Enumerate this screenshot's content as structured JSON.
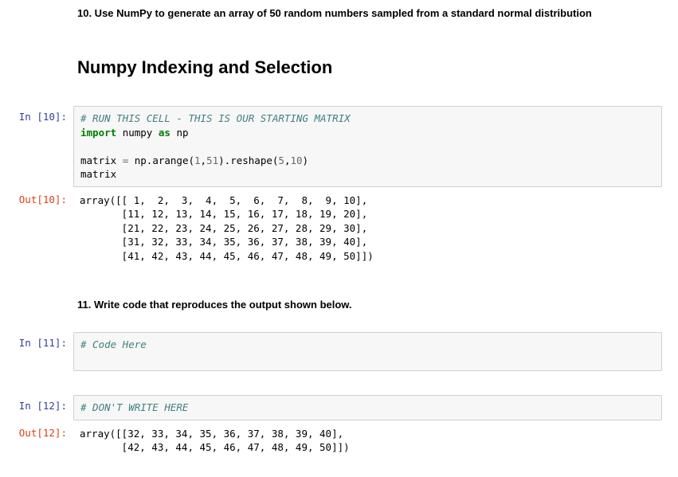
{
  "markdown": {
    "q10": "10. Use NumPy to generate an array of 50 random numbers sampled from a standard normal distribution",
    "heading": "Numpy Indexing and Selection",
    "q11": "11. Write code that reproduces the output shown below."
  },
  "cells": {
    "in10": {
      "prompt": "In [10]:",
      "code": {
        "comment1": "# RUN THIS CELL - THIS IS OUR STARTING MATRIX",
        "kw_import": "import",
        "mod": "numpy",
        "kw_as": "as",
        "alias": "np",
        "blank": "",
        "line3_a": "matrix ",
        "line3_op": "=",
        "line3_b": " np.arange(",
        "line3_n1": "1",
        "line3_c": ",",
        "line3_n2": "51",
        "line3_d": ").reshape(",
        "line3_n3": "5",
        "line3_e": ",",
        "line3_n4": "10",
        "line3_f": ")",
        "line4": "matrix"
      }
    },
    "out10": {
      "prompt": "Out[10]:",
      "text": "array([[ 1,  2,  3,  4,  5,  6,  7,  8,  9, 10],\n       [11, 12, 13, 14, 15, 16, 17, 18, 19, 20],\n       [21, 22, 23, 24, 25, 26, 27, 28, 29, 30],\n       [31, 32, 33, 34, 35, 36, 37, 38, 39, 40],\n       [41, 42, 43, 44, 45, 46, 47, 48, 49, 50]])"
    },
    "in11": {
      "prompt": "In [11]:",
      "comment": "# Code Here",
      "pad": "\n\n"
    },
    "in12": {
      "prompt": "In [12]:",
      "comment": "# DON'T WRITE HERE"
    },
    "out12": {
      "prompt": "Out[12]:",
      "text": "array([[32, 33, 34, 35, 36, 37, 38, 39, 40],\n       [42, 43, 44, 45, 46, 47, 48, 49, 50]])"
    }
  }
}
